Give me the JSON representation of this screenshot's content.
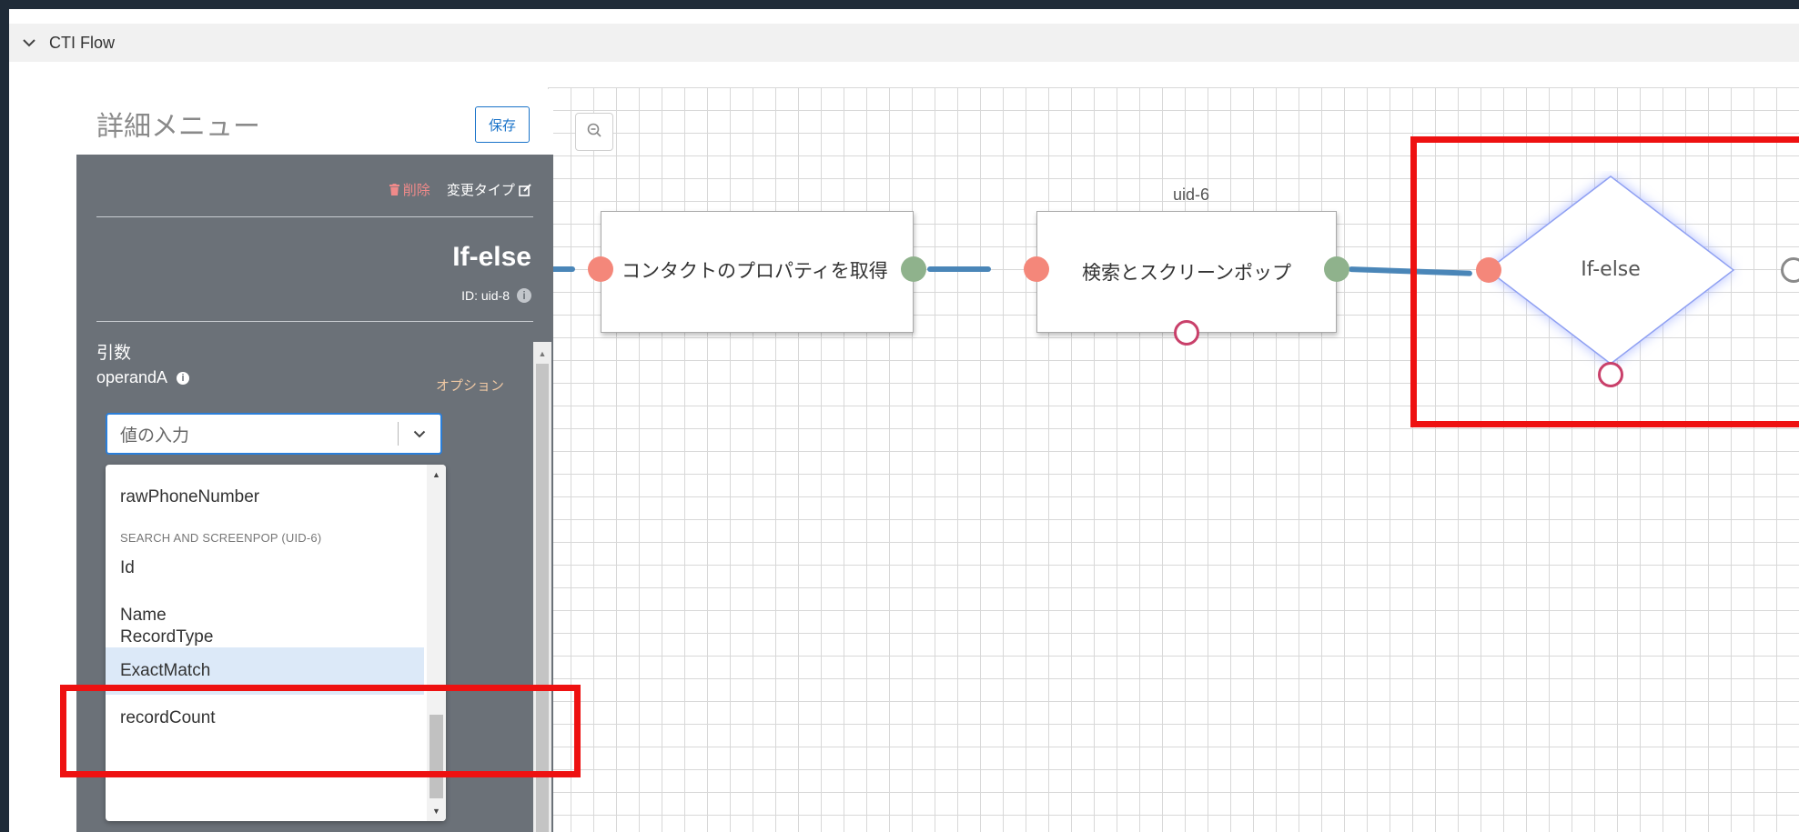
{
  "section": {
    "title": "CTI Flow",
    "chevron_icon": "chevron-down-icon"
  },
  "canvas": {
    "zoom_icon": "zoom-out-icon",
    "nodes": [
      {
        "id": "contact",
        "label": "コンタクトのプロパティを取得"
      },
      {
        "id": "search",
        "uid_label": "uid-6",
        "label": "検索とスクリーンポップ"
      },
      {
        "id": "ifelse",
        "label": "If-else"
      }
    ]
  },
  "detail": {
    "title": "詳細メニュー",
    "save_label": "保存",
    "delete_label": "削除",
    "change_type_label": "変更タイプ",
    "node_name": "If-else",
    "node_id": "ID: uid-8",
    "arguments_label": "引数",
    "operand_label": "operandA",
    "option_label": "オプション",
    "input_placeholder": "値の入力"
  },
  "dropdown": {
    "items": [
      {
        "label": "rawPhoneNumber",
        "selected": false
      },
      {
        "label": "Id",
        "selected": false
      },
      {
        "label": "Name",
        "selected": false
      },
      {
        "label": "RecordType",
        "selected": false
      },
      {
        "label": "ExactMatch",
        "selected": true
      },
      {
        "label": "recordCount",
        "selected": false
      }
    ],
    "group_label": "SEARCH AND SCREENPOP (UID-6)"
  },
  "colors": {
    "accent": "#1a73c9",
    "highlight": "#ee1111",
    "panel_bg": "#6b7178",
    "wire": "#4a86b8",
    "port_in": "#f4877a",
    "port_out": "#8fb28c",
    "port_error": "#c9406a"
  }
}
